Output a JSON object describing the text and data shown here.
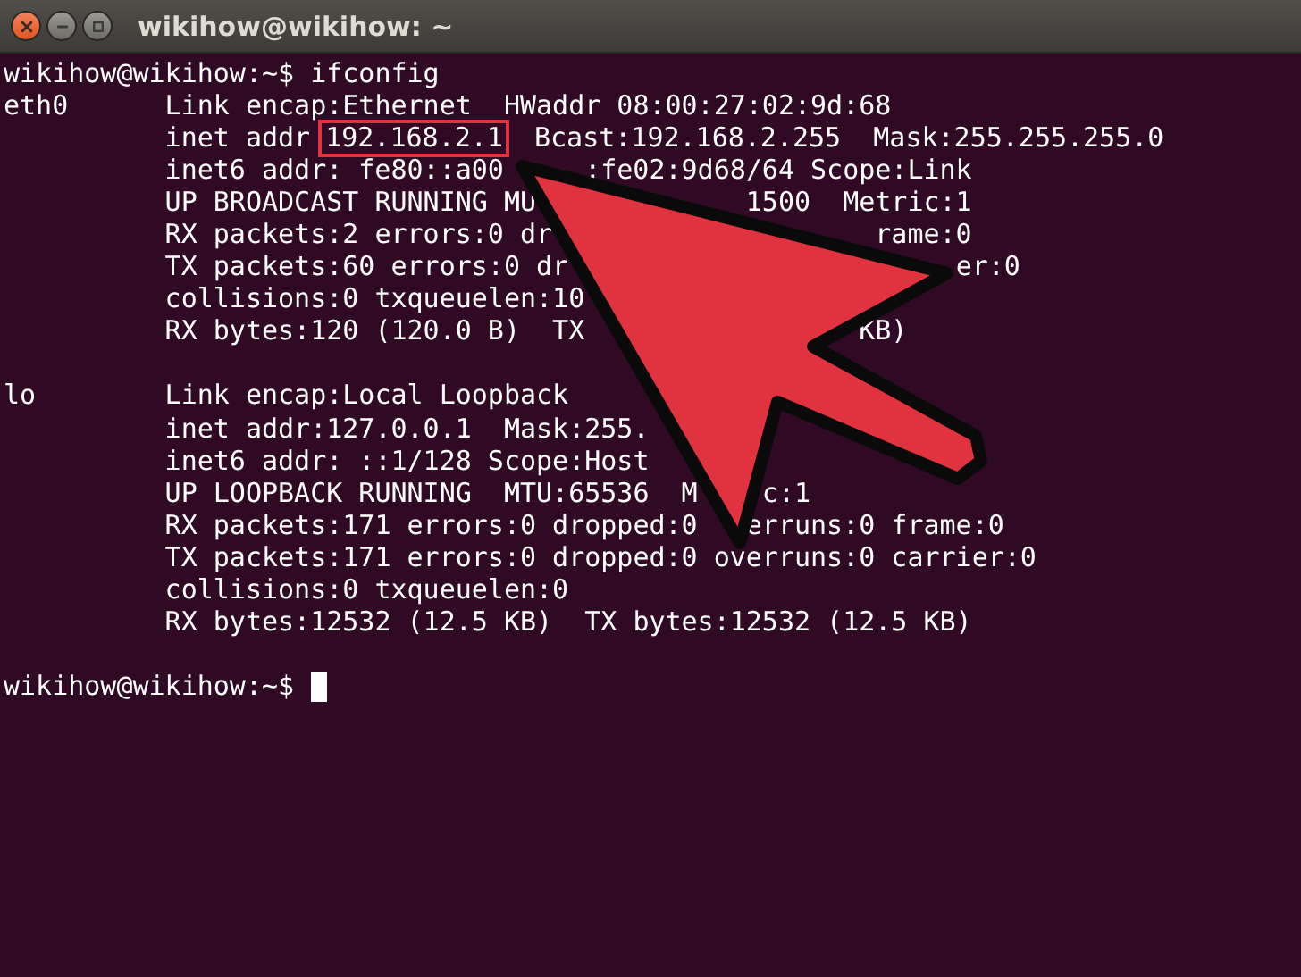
{
  "window": {
    "title": "wikihow@wikihow: ~"
  },
  "window_controls": [
    {
      "kind": "close"
    },
    {
      "kind": "minimize"
    },
    {
      "kind": "maximize"
    }
  ],
  "terminal": {
    "command_line": {
      "prompt": "wikihow@wikihow:~$",
      "command": "ifconfig"
    },
    "interfaces": [
      {
        "name": "eth0",
        "lines": [
          {
            "segments": [
              "Link encap:Ethernet  HWaddr 08:00:27:02:9d:68"
            ]
          },
          {
            "segments": [
              "inet addr",
              {
                "text": "192.168.2.1",
                "highlighted": true
              },
              "Bcast:192.168.2.255  Mask:255.255.255.0"
            ]
          },
          {
            "segments": [
              "inet6 addr:",
              "fe80::a00",
              ":fe02:9d68/64 Scope:Link"
            ]
          },
          {
            "segments": [
              "UP BROADCAST RUNNING MU",
              "1500  Metric:1"
            ]
          },
          {
            "segments": [
              "RX packets:2 errors:0 dr",
              "rame:0"
            ]
          },
          {
            "segments": [
              "TX packets:60 errors:0 dr",
              "er:0"
            ]
          },
          {
            "segments": [
              "collisions:0 txqueuelen:10"
            ]
          },
          {
            "segments": [
              "RX bytes:120 (120.0 B)  TX",
              "KB)"
            ]
          }
        ]
      },
      {
        "name": "lo",
        "lines": [
          {
            "segments": [
              "Link encap:Local Loopback"
            ]
          },
          {
            "segments": [
              "inet addr:127.0.0.1  Mask:255."
            ]
          },
          {
            "segments": [
              "inet6 addr: ::1/128 Scope:Host"
            ]
          },
          {
            "segments": [
              "UP LOOPBACK RUNNING  MTU:65536  M",
              "c:1"
            ]
          },
          {
            "segments": [
              "RX packets:171 errors:0 dropped:0",
              "erruns:0 frame:0"
            ]
          },
          {
            "segments": [
              "TX packets:171 errors:0 dropped:0 overruns:0 carrier:0"
            ]
          },
          {
            "segments": [
              "collisions:0 txqueuelen:0"
            ]
          },
          {
            "segments": [
              "RX bytes:12532 (12.5 KB)  TX bytes:12532 (12.5 KB)"
            ]
          }
        ]
      }
    ],
    "final_prompt": {
      "prompt": "wikihow@wikihow:~$",
      "cursor": true
    }
  }
}
